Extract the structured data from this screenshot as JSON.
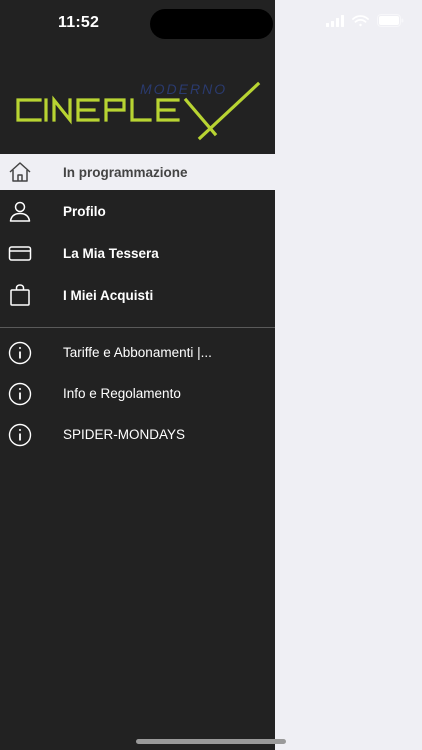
{
  "status_bar": {
    "time": "11:52"
  },
  "brand": {
    "logo_small": "MODERNO",
    "logo_main": "CINEPLEX",
    "accent": "#b8d432"
  },
  "menu": {
    "items": [
      {
        "label": "In programmazione",
        "icon": "home-icon",
        "active": true
      },
      {
        "label": "Profilo",
        "icon": "user-icon"
      },
      {
        "label": "La Mia Tessera",
        "icon": "card-icon"
      },
      {
        "label": "I Miei Acquisti",
        "icon": "bag-icon"
      }
    ],
    "info_items": [
      {
        "label": "Tariffe e Abbonamenti |...",
        "icon": "info-icon"
      },
      {
        "label": "Info e Regolamento",
        "icon": "info-icon"
      },
      {
        "label": "SPIDER-MONDAYS",
        "icon": "info-icon"
      }
    ]
  },
  "colors": {
    "drawer_bg": "#222222",
    "page_bg": "#efeff4"
  }
}
